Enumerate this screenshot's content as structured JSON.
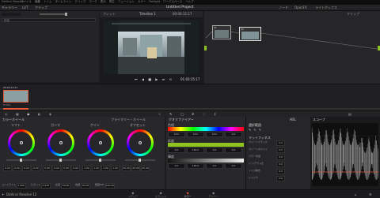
{
  "menubar": {
    "app": "DaVinci Resolve",
    "items": [
      "ファイル",
      "編集",
      "トリム",
      "タイムライン",
      "クリップ",
      "マーク",
      "表示",
      "再生",
      "フュージョン",
      "カラー",
      "Fairlight",
      "ワークスペース",
      "ヘルプ"
    ]
  },
  "toolbar": {
    "gallery": "ギャラリー",
    "luts": "LUT",
    "clips": "クリップ",
    "project_title": "Untitled Project",
    "node_label": "ノード",
    "lightbox": "ライトボックス",
    "effects": "OpenFX",
    "zoom": "32%",
    "timecode_display": "00:00:15:17",
    "timeline_name": "Timeline 1",
    "clip_menu": "クリップ"
  },
  "viewer": {
    "timecode": "01:03:15:17",
    "zoom_label": "フィット"
  },
  "left_panel": {
    "search_placeholder": "検索"
  },
  "clips": [
    {
      "id": "01",
      "timecode": "00:00:15:17",
      "codec": "H.264"
    }
  ],
  "nodes": [
    {
      "label": "01"
    },
    {
      "label": "02"
    }
  ],
  "colorwheels": {
    "panel_title": "カラーホイール",
    "mode": "プライマリー・ホイール",
    "wheels": [
      {
        "name": "リフト",
        "values": [
          "0.00",
          "0.00",
          "0.00",
          "0.00"
        ]
      },
      {
        "name": "ガンマ",
        "values": [
          "0.00",
          "0.00",
          "0.00",
          "0.00"
        ]
      },
      {
        "name": "ゲイン",
        "values": [
          "1.00",
          "1.00",
          "1.00",
          "1.00"
        ]
      },
      {
        "name": "オフセット",
        "values": [
          "25.00",
          "25.00",
          "25.00"
        ]
      }
    ],
    "bottom_params": [
      {
        "label": "コントラスト",
        "value": "1.000"
      },
      {
        "label": "ピボット",
        "value": "0.435"
      },
      {
        "label": "彩度",
        "value": "50.00"
      },
      {
        "label": "色相",
        "value": "50.00"
      },
      {
        "label": "輝度MIX",
        "value": "100.00"
      }
    ]
  },
  "qualifier": {
    "panel_title": "クオリファイアー",
    "rows": [
      {
        "label": "色相",
        "vals": [
          "50.0",
          "50.0",
          "50.0",
          "0.0"
        ]
      },
      {
        "label": "彩度",
        "vals": [
          "0.0",
          "100.0",
          "0.0",
          "0.0"
        ]
      },
      {
        "label": "輝度",
        "vals": [
          "0.0",
          "100.0",
          "0.0",
          "0.0"
        ]
      }
    ]
  },
  "matte": {
    "title": "選択範囲",
    "refine_title": "マットフィネス",
    "items": [
      {
        "label": "クリーンブラック",
        "value": "0.0"
      },
      {
        "label": "クリーンホワイト",
        "value": "0.0"
      },
      {
        "label": "ブラー半径",
        "value": "0.0"
      },
      {
        "label": "イン/アウト比",
        "value": "0.0"
      },
      {
        "label": "ノイズ除去",
        "value": "0.0"
      },
      {
        "label": "シャドウ",
        "value": "0.0"
      }
    ]
  },
  "scopes": {
    "title": "スコープ",
    "hsl": "HSL"
  },
  "footer": {
    "app_name": "DaVinci Resolve 12",
    "pages": [
      "メディア",
      "エディット",
      "カラー",
      "デリバー"
    ],
    "active_page": "カラー"
  },
  "colors": {
    "accent": "#e05a3a",
    "lime": "#8fc31f",
    "node_border": "#bbbbbb"
  }
}
